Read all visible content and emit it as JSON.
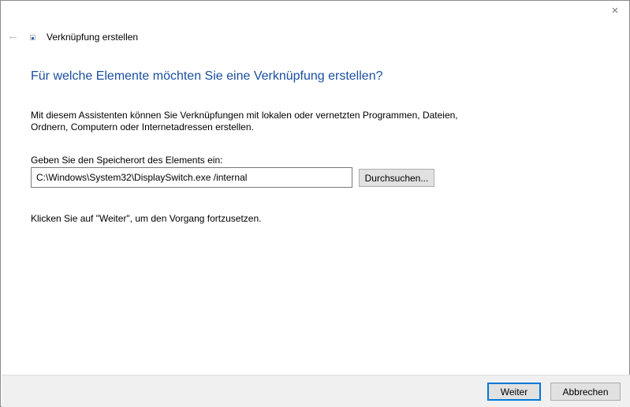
{
  "window": {
    "title": "Verknüpfung erstellen",
    "close_icon": "×",
    "back_icon": "←"
  },
  "heading": "Für welche Elemente möchten Sie eine Verknüpfung erstellen?",
  "description": "Mit diesem Assistenten können Sie Verknüpfungen mit lokalen oder vernetzten Programmen, Dateien, Ordnern, Computern oder Internetadressen erstellen.",
  "location": {
    "label": "Geben Sie den Speicherort des Elements ein:",
    "value": "C:\\Windows\\System32\\DisplaySwitch.exe /internal",
    "browse_label": "Durchsuchen..."
  },
  "hint": "Klicken Sie auf \"Weiter\", um den Vorgang fortzusetzen.",
  "footer": {
    "next_label": "Weiter",
    "cancel_label": "Abbrechen"
  }
}
